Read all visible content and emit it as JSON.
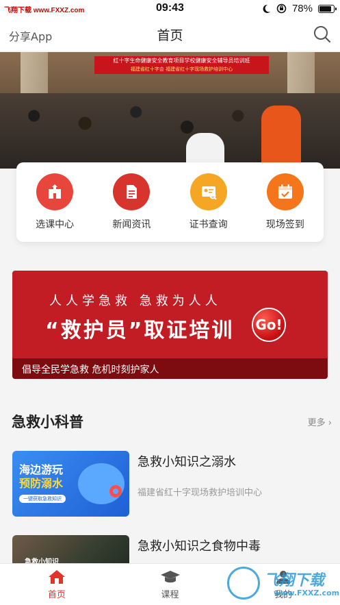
{
  "status_bar": {
    "source_tag": "飞翔下载 www.FXXZ.com",
    "time": "09:43",
    "battery": "78%"
  },
  "nav": {
    "share_label": "分享App",
    "title": "首页",
    "search_icon": "search-icon"
  },
  "hero": {
    "banner_line1": "红十字生命健康安全教育项目学校健康安全辅导员培训班",
    "banner_line2": "福建省红十字会   福建省红十字现场救护培训中心"
  },
  "quick_actions": [
    {
      "label": "选课中心",
      "icon": "course-building-icon",
      "color": "#e8453c"
    },
    {
      "label": "新闻资讯",
      "icon": "news-document-icon",
      "color": "#e8453c"
    },
    {
      "label": "证书查询",
      "icon": "certificate-search-icon",
      "color": "#f5a623"
    },
    {
      "label": "现场签到",
      "icon": "calendar-check-icon",
      "color": "#f5761a"
    }
  ],
  "promo": {
    "top_line": "人人学急救 急救为人人",
    "main_line": "“救护员”取证培训",
    "badge": "Go!",
    "slogan": "倡导全民学急救  危机时刻护家人"
  },
  "section": {
    "title": "急救小科普",
    "more": "更多 ›"
  },
  "articles": [
    {
      "title": "急救小知识之溺水",
      "source": "福建省红十字现场救护培训中心",
      "thumb_line1": "海边游玩",
      "thumb_line2": "预防溺水",
      "thumb_pill": "一键获取急救知识"
    },
    {
      "title": "急救小知识之食物中毒",
      "thumb_label": "急救小知识"
    }
  ],
  "tabs": [
    {
      "label": "首页",
      "icon": "home-icon",
      "active": true,
      "color": "#e0332b"
    },
    {
      "label": "课程",
      "icon": "graduation-cap-icon",
      "active": false,
      "color": "#555555"
    },
    {
      "label": "我的",
      "icon": "user-icon",
      "active": false,
      "color": "#555555"
    }
  ],
  "watermark": {
    "text": "飞翔下载",
    "url": "www.FXXZ.com"
  }
}
